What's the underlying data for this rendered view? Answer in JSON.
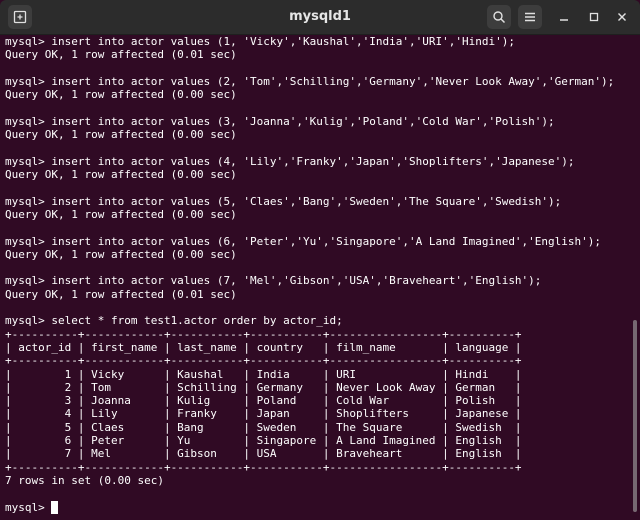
{
  "window": {
    "title": "mysqld1"
  },
  "icons": {
    "new_tab": "new-tab-icon",
    "search": "search-icon",
    "menu": "hamburger-menu-icon",
    "minimize": "minimize-icon",
    "maximize": "maximize-icon",
    "close": "close-icon"
  },
  "colors": {
    "terminal_bg": "#300a24",
    "titlebar_bg": "#2c2c2c",
    "text": "#ffffff"
  },
  "terminal": {
    "lines": [
      "mysql> insert into actor values (1, 'Vicky','Kaushal','India','URI','Hindi');",
      "Query OK, 1 row affected (0.01 sec)",
      "",
      "mysql> insert into actor values (2, 'Tom','Schilling','Germany','Never Look Away','German');",
      "Query OK, 1 row affected (0.00 sec)",
      "",
      "mysql> insert into actor values (3, 'Joanna','Kulig','Poland','Cold War','Polish');",
      "Query OK, 1 row affected (0.00 sec)",
      "",
      "mysql> insert into actor values (4, 'Lily','Franky','Japan','Shoplifters','Japanese');",
      "Query OK, 1 row affected (0.00 sec)",
      "",
      "mysql> insert into actor values (5, 'Claes','Bang','Sweden','The Square','Swedish');",
      "Query OK, 1 row affected (0.00 sec)",
      "",
      "mysql> insert into actor values (6, 'Peter','Yu','Singapore','A Land Imagined','English');",
      "Query OK, 1 row affected (0.00 sec)",
      "",
      "mysql> insert into actor values (7, 'Mel','Gibson','USA','Braveheart','English');",
      "Query OK, 1 row affected (0.01 sec)",
      "",
      "mysql> select * from test1.actor order by actor_id;",
      "+----------+------------+-----------+-----------+-----------------+----------+",
      "| actor_id | first_name | last_name | country   | film_name       | language |",
      "+----------+------------+-----------+-----------+-----------------+----------+",
      "|        1 | Vicky      | Kaushal   | India     | URI             | Hindi    |",
      "|        2 | Tom        | Schilling | Germany   | Never Look Away | German   |",
      "|        3 | Joanna     | Kulig     | Poland    | Cold War        | Polish   |",
      "|        4 | Lily       | Franky    | Japan     | Shoplifters     | Japanese |",
      "|        5 | Claes      | Bang      | Sweden    | The Square      | Swedish  |",
      "|        6 | Peter      | Yu        | Singapore | A Land Imagined | English  |",
      "|        7 | Mel        | Gibson    | USA       | Braveheart      | English  |",
      "+----------+------------+-----------+-----------+-----------------+----------+",
      "7 rows in set (0.00 sec)",
      "",
      "mysql> "
    ]
  }
}
